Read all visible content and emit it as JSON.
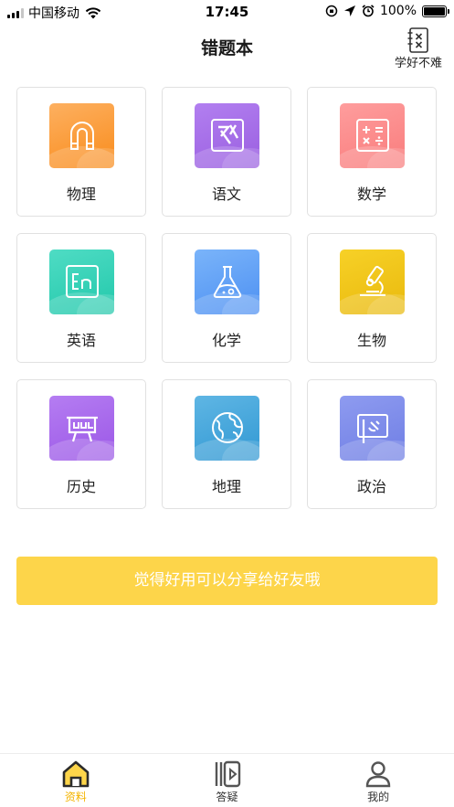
{
  "status_bar": {
    "carrier": "中国移动",
    "time": "17:45",
    "battery": "100%"
  },
  "header": {
    "title": "错题本",
    "action_label": "学好不难"
  },
  "subjects": [
    {
      "label": "物理",
      "icon": "magnet-icon",
      "color": "#fb9c35"
    },
    {
      "label": "语文",
      "icon": "translate-icon",
      "color": "#a46ee6"
    },
    {
      "label": "数学",
      "icon": "calculator-icon",
      "color": "#fb8c8c"
    },
    {
      "label": "英语",
      "icon": "english-icon",
      "color": "#34d2b8"
    },
    {
      "label": "化学",
      "icon": "flask-icon",
      "color": "#5a9ef6"
    },
    {
      "label": "生物",
      "icon": "microscope-icon",
      "color": "#f1c415"
    },
    {
      "label": "历史",
      "icon": "history-board-icon",
      "color": "#a965ec"
    },
    {
      "label": "地理",
      "icon": "globe-icon",
      "color": "#47a6db"
    },
    {
      "label": "政治",
      "icon": "flag-icon",
      "color": "#7d8bea"
    }
  ],
  "share": {
    "label": "觉得好用可以分享给好友哦"
  },
  "tabs": [
    {
      "label": "资料",
      "icon": "home-icon",
      "active": true
    },
    {
      "label": "答疑",
      "icon": "video-icon",
      "active": false
    },
    {
      "label": "我的",
      "icon": "user-icon",
      "active": false
    }
  ],
  "colors": {
    "accent": "#f4b400",
    "share_button": "#fdd54a"
  }
}
